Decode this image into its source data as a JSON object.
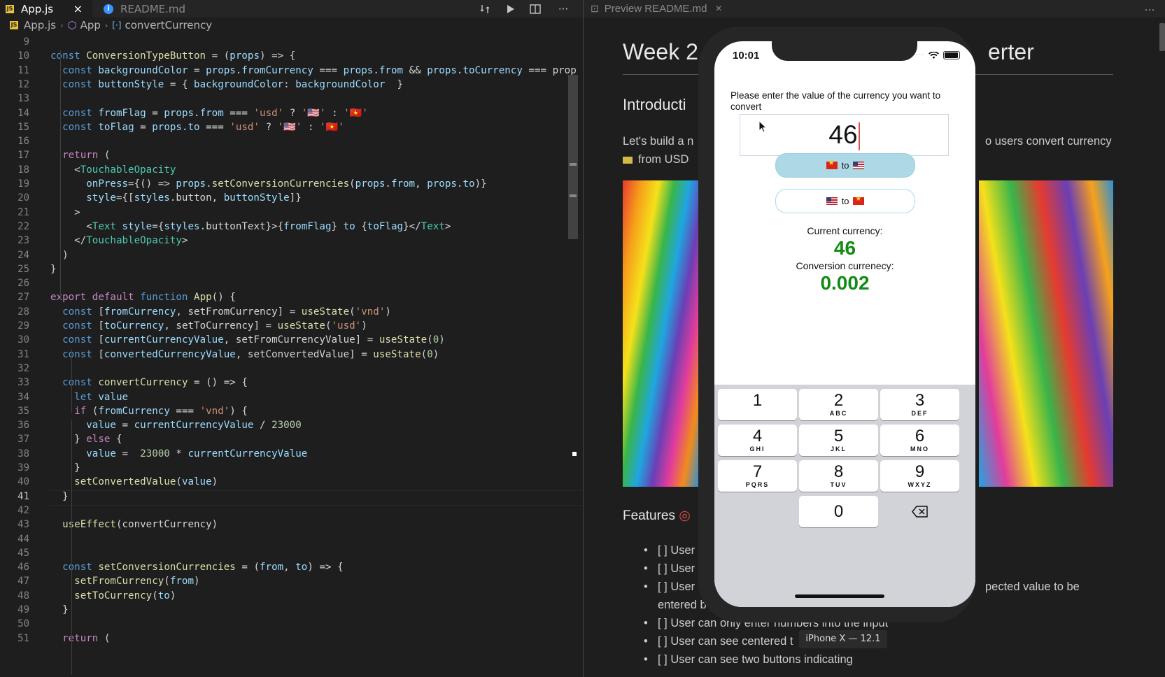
{
  "editor": {
    "tabs": [
      {
        "label": "App.js",
        "close": "×"
      },
      {
        "label": "README.md"
      }
    ],
    "actions": {
      "more": "···"
    },
    "breadcrumb": {
      "file": "App.js",
      "component": "App",
      "symbol": "convertCurrency"
    },
    "line_numbers": [
      "9",
      "10",
      "11",
      "12",
      "13",
      "14",
      "15",
      "16",
      "17",
      "18",
      "19",
      "20",
      "21",
      "22",
      "23",
      "24",
      "25",
      "26",
      "27",
      "28",
      "29",
      "30",
      "31",
      "32",
      "33",
      "34",
      "35",
      "36",
      "37",
      "38",
      "39",
      "40",
      "41",
      "42",
      "43",
      "44",
      "45",
      "46",
      "47",
      "48",
      "49",
      "50",
      "51"
    ],
    "current_line": "41",
    "code_lines": [
      "",
      "const ConversionTypeButton = (props) => {",
      "  const backgroundColor = props.fromCurrency === props.from && props.toCurrency === prop",
      "  const buttonStyle = { backgroundColor: backgroundColor  }",
      "",
      "  const fromFlag = props.from === 'usd' ? '🇺🇸' : '🇻🇳'",
      "  const toFlag = props.to === 'usd' ? '🇺🇸' : '🇻🇳'",
      "",
      "  return (",
      "    <TouchableOpacity",
      "      onPress={() => props.setConversionCurrencies(props.from, props.to)}",
      "      style={[styles.button, buttonStyle]}",
      "    >",
      "      <Text style={styles.buttonText}>{fromFlag} to {toFlag}</Text>",
      "    </TouchableOpacity>",
      "  )",
      "}",
      "",
      "export default function App() {",
      "  const [fromCurrency, setFromCurrency] = useState('vnd')",
      "  const [toCurrency, setToCurrency] = useState('usd')",
      "  const [currentCurrencyValue, setFromCurrencyValue] = useState(0)",
      "  const [convertedCurrencyValue, setConvertedValue] = useState(0)",
      "",
      "  const convertCurrency = () => {",
      "    let value",
      "    if (fromCurrency === 'vnd') {",
      "      value = currentCurrencyValue / 23000",
      "    } else {",
      "      value =  23000 * currentCurrencyValue",
      "    }",
      "    setConvertedValue(value)",
      "  }",
      "",
      "  useEffect(convertCurrency)",
      "",
      "",
      "  const setConversionCurrencies = (from, to) => {",
      "    setFromCurrency(from)",
      "    setToCurrency(to)",
      "  }",
      "",
      "  return ("
    ]
  },
  "preview": {
    "tab_label": "Preview README.md",
    "close": "×",
    "more": "···",
    "title_left": "Week 2",
    "title_right": "erter",
    "intro_heading": "Introducti",
    "intro_text_left": "Let's build a n",
    "intro_text_right": "o users convert currency",
    "intro_text_line2": "from USD",
    "features_heading": "Features",
    "features": [
      {
        "left": "[ ] User",
        "right": ""
      },
      {
        "left": "[ ] User",
        "right": ""
      },
      {
        "left": "[ ] User",
        "right": "pected value to be"
      },
      {
        "left": "entered b",
        "right": ""
      },
      {
        "left": "[ ] User can only enter numbers into the input",
        "right": ""
      },
      {
        "left": "[ ] User can see centered t",
        "right": ""
      },
      {
        "left": "[ ] User can see two buttons indicating",
        "right": ""
      }
    ]
  },
  "simulator": {
    "time": "10:01",
    "prompt": "Please enter the value of the currency you want to convert",
    "input_value": "46",
    "buttons": [
      {
        "to_word": "to",
        "active_color": "#add8e6"
      },
      {
        "to_word": "to"
      }
    ],
    "current_label": "Current currency:",
    "current_value": "46",
    "conversion_label": "Conversion currenecy:",
    "conversion_value": "0.002",
    "value_color": "#158a15",
    "keypad": [
      {
        "d": "1",
        "l": ""
      },
      {
        "d": "2",
        "l": "ABC"
      },
      {
        "d": "3",
        "l": "DEF"
      },
      {
        "d": "4",
        "l": "GHI"
      },
      {
        "d": "5",
        "l": "JKL"
      },
      {
        "d": "6",
        "l": "MNO"
      },
      {
        "d": "7",
        "l": "PQRS"
      },
      {
        "d": "8",
        "l": "TUV"
      },
      {
        "d": "9",
        "l": "WXYZ"
      },
      {
        "d": "0",
        "l": ""
      }
    ],
    "device_label": "iPhone X — 12.1"
  }
}
